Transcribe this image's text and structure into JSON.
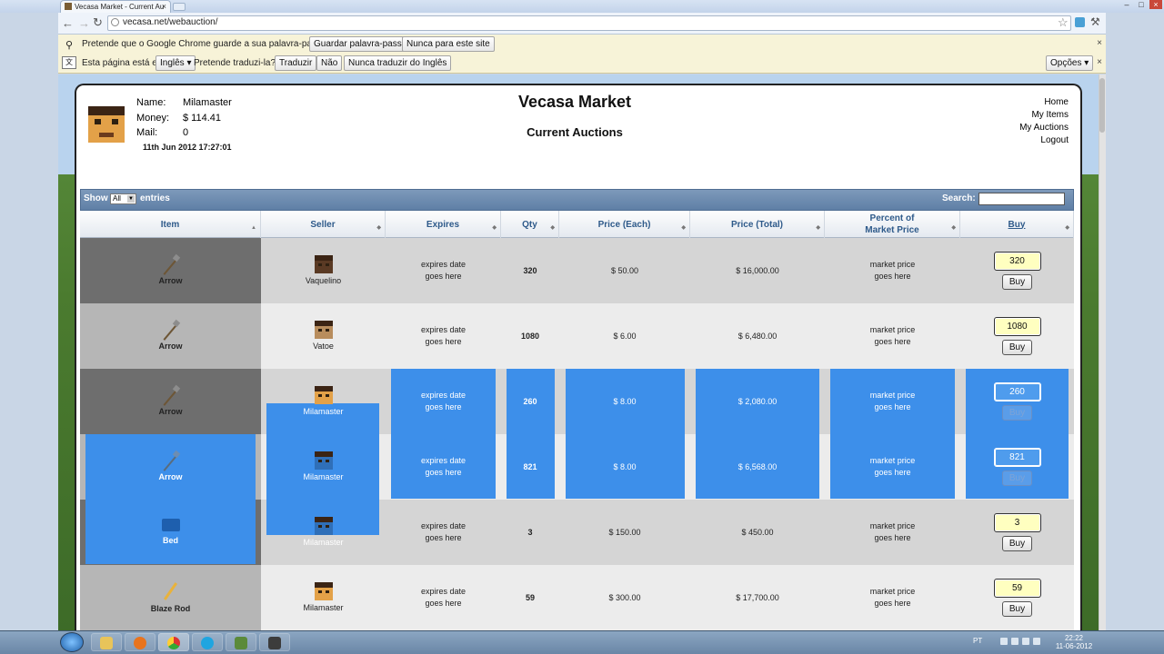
{
  "browser": {
    "tab_title": "Vecasa Market - Current Au",
    "tab_close": "×",
    "url": "vecasa.net/webauction/",
    "password_bar": {
      "text": "Pretende que o Google Chrome guarde a sua palavra-passe?",
      "save": "Guardar palavra-passe",
      "never": "Nunca para este site",
      "close": "×"
    },
    "translate_bar": {
      "prefix": "Esta página está em",
      "language": "Inglês ▾",
      "question": "Pretende traduzi-la?",
      "translate": "Traduzir",
      "no": "Não",
      "never": "Nunca traduzir do Inglês",
      "options": "Opções ▾",
      "close": "×"
    },
    "window_controls": [
      "–",
      "□",
      "×"
    ]
  },
  "header": {
    "name_label": "Name:",
    "name_value": "Milamaster",
    "money_label": "Money:",
    "money_value": "$ 114.41",
    "mail_label": "Mail:",
    "mail_value": "0",
    "datetime": "11th Jun 2012 17:27:01",
    "title": "Vecasa Market",
    "subtitle": "Current Auctions",
    "nav": [
      "Home",
      "My Items",
      "My Auctions",
      "Logout"
    ]
  },
  "table_controls": {
    "show": "Show",
    "show_value": "All",
    "entries": "entries",
    "search": "Search:"
  },
  "columns": [
    "Item",
    "Seller",
    "Expires",
    "Qty",
    "Price (Each)",
    "Price (Total)",
    "Percent of\nMarket Price",
    "Buy"
  ],
  "rows": [
    {
      "item": "Arrow",
      "seller": "Vaquelino",
      "expires": "expires date\ngoes here",
      "qty": "320",
      "price_each": "$ 50.00",
      "price_total": "$ 16,000.00",
      "market": "market price\ngoes here",
      "buy_qty": "320",
      "buy": "Buy"
    },
    {
      "item": "Arrow",
      "seller": "Vatoe",
      "expires": "expires date\ngoes here",
      "qty": "1080",
      "price_each": "$ 6.00",
      "price_total": "$ 6,480.00",
      "market": "market price\ngoes here",
      "buy_qty": "1080",
      "buy": "Buy"
    },
    {
      "item": "Arrow",
      "seller": "Milamaster",
      "expires": "expires date\ngoes here",
      "qty": "260",
      "price_each": "$ 8.00",
      "price_total": "$ 2,080.00",
      "market": "market price\ngoes here",
      "buy_qty": "260",
      "buy": "Buy"
    },
    {
      "item": "Arrow",
      "seller": "Milamaster",
      "expires": "expires date\ngoes here",
      "qty": "821",
      "price_each": "$ 8.00",
      "price_total": "$ 6,568.00",
      "market": "market price\ngoes here",
      "buy_qty": "821",
      "buy": "Buy"
    },
    {
      "item": "Bed",
      "seller": "Milamaster",
      "expires": "expires date\ngoes here",
      "qty": "3",
      "price_each": "$ 150.00",
      "price_total": "$ 450.00",
      "market": "market price\ngoes here",
      "buy_qty": "3",
      "buy": "Buy"
    },
    {
      "item": "Blaze Rod",
      "seller": "Milamaster",
      "expires": "expires date\ngoes here",
      "qty": "59",
      "price_each": "$ 300.00",
      "price_total": "$ 17,700.00",
      "market": "market price\ngoes here",
      "buy_qty": "59",
      "buy": "Buy"
    }
  ],
  "taskbar": {
    "lang": "PT",
    "time": "22:22",
    "date": "11-06-2012"
  },
  "colors": {
    "selection": "#3d8fea",
    "header_bar": "#6f8db2",
    "qty_box": "#ffffc0"
  },
  "icons": [
    "back-icon",
    "forward-icon",
    "reload-icon",
    "star-icon",
    "wrench-icon",
    "key-icon",
    "translate-icon",
    "arrow-item-icon",
    "bed-item-icon",
    "blaze-rod-item-icon",
    "player-head-icon",
    "windows-start-icon"
  ]
}
